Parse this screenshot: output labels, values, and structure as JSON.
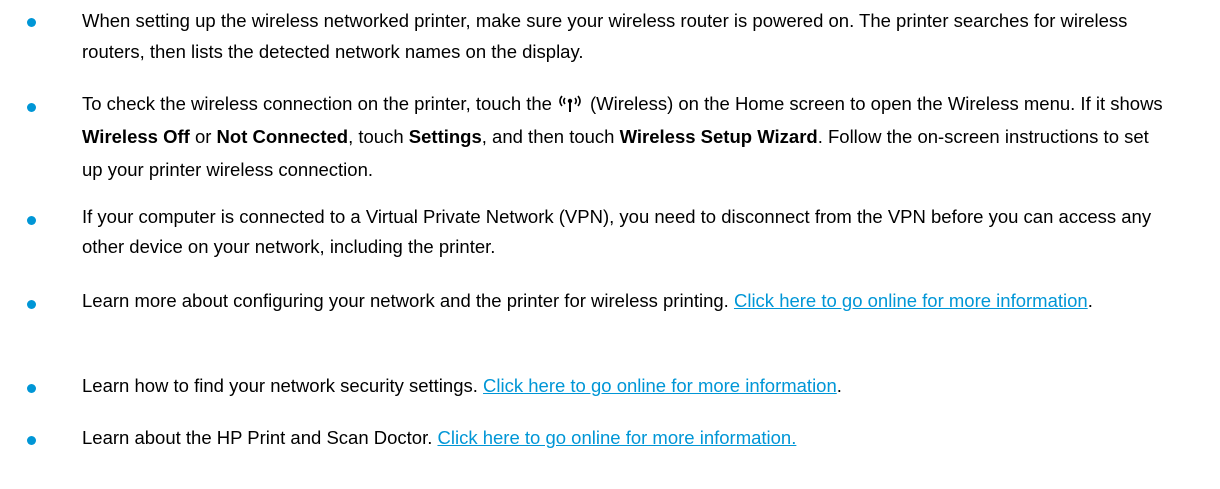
{
  "colors": {
    "bullet": "#0096d6",
    "link": "#0096d6",
    "text": "#000000"
  },
  "items": [
    {
      "text": "When setting up the wireless networked printer, make sure your wireless router is powered on. The printer searches for wireless routers, then lists the detected network names on the display."
    },
    {
      "part1": "To check the wireless connection on the printer, touch the",
      "icon": "wireless-icon",
      "part2": "(Wireless) on the Home screen to open the Wireless menu. If it shows",
      "bold1": "Wireless Off",
      "part3": "or",
      "bold2": "Not Connected",
      "part4": ", touch",
      "bold3": "Settings",
      "part5": ", and then touch",
      "bold4": "Wireless Setup Wizard",
      "part6": ". Follow the on-screen instructions to set up your printer wireless connection."
    },
    {
      "text": "If your computer is connected to a Virtual Private Network (VPN), you need to disconnect from the VPN before you can access any other device on your network, including the printer."
    },
    {
      "text": "Learn more about configuring your network and the printer for wireless printing.",
      "link": "Click here to go online for more information",
      "suffix": "."
    },
    {
      "text": "Learn how to find your network security settings.",
      "link": "Click here to go online for more information",
      "suffix": "."
    },
    {
      "text": "Learn about the HP Print and Scan Doctor.",
      "link": "Click here to go online for more information."
    }
  ]
}
